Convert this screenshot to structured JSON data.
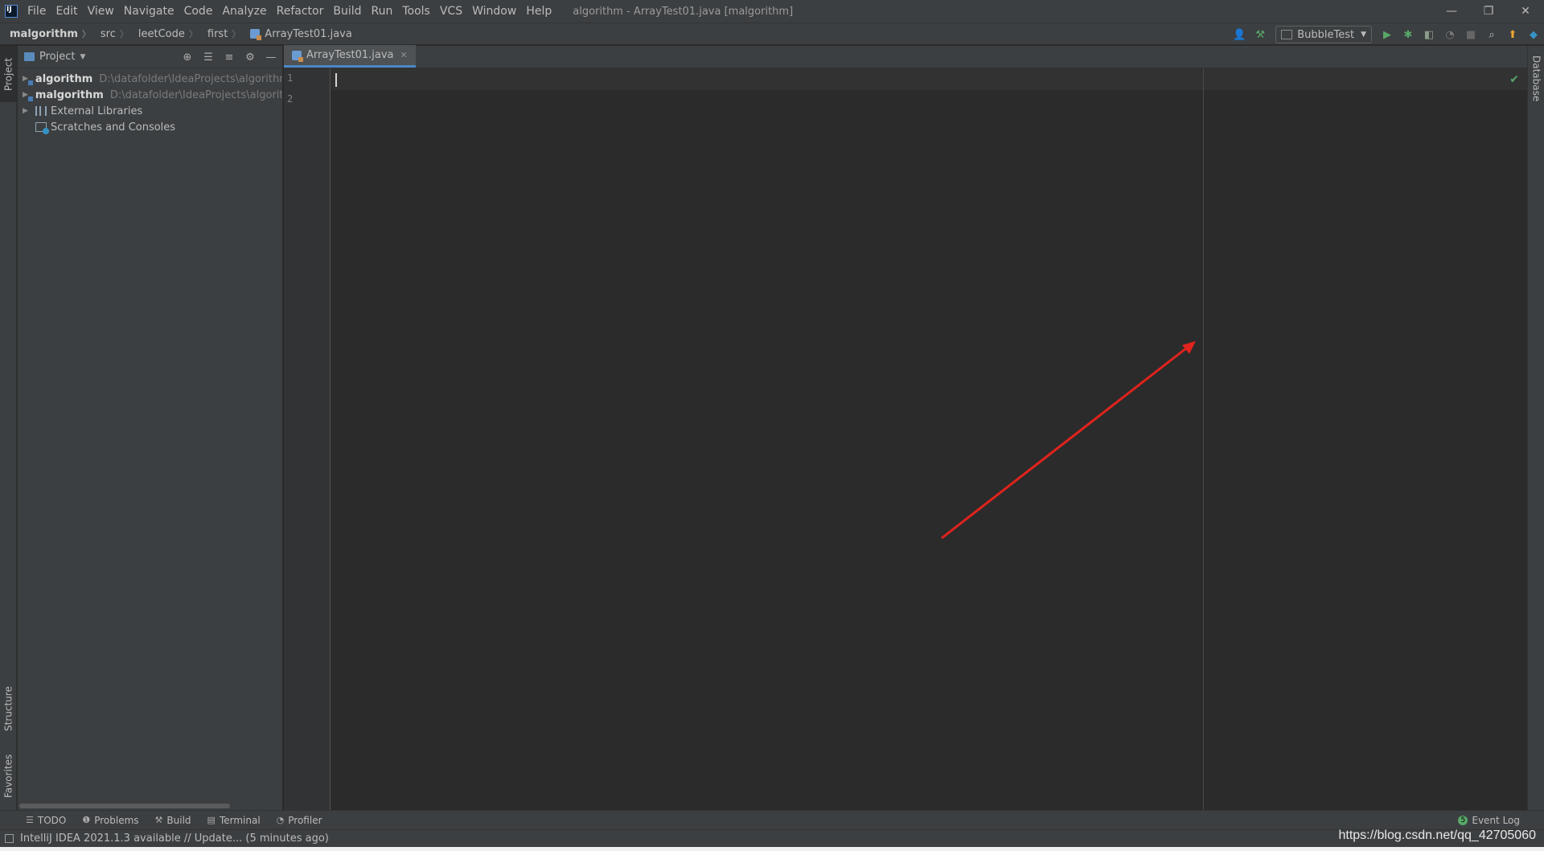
{
  "window": {
    "title": "algorithm - ArrayTest01.java [malgorithm]",
    "minimize": "—",
    "restore": "❐",
    "close": "✕"
  },
  "menu": [
    "File",
    "Edit",
    "View",
    "Navigate",
    "Code",
    "Analyze",
    "Refactor",
    "Build",
    "Run",
    "Tools",
    "VCS",
    "Window",
    "Help"
  ],
  "breadcrumb": [
    "malgorithm",
    "src",
    "leetCode",
    "first",
    "ArrayTest01.java"
  ],
  "toolbar": {
    "run_config": "BubbleTest"
  },
  "project_panel": {
    "title": "Project",
    "tree": [
      {
        "name": "algorithm",
        "path": "D:\\datafolder\\IdeaProjects\\algorithm\\"
      },
      {
        "name": "malgorithm",
        "path": "D:\\datafolder\\IdeaProjects\\algorithm"
      },
      {
        "name": "External Libraries"
      },
      {
        "name": "Scratches and Consoles"
      }
    ]
  },
  "left_stripe": {
    "project": "Project",
    "structure": "Structure",
    "favorites": "Favorites"
  },
  "right_stripe": {
    "database": "Database"
  },
  "editor": {
    "tab": "ArrayTest01.java",
    "line_numbers": [
      "1",
      "2"
    ]
  },
  "bottom_tabs": [
    "TODO",
    "Problems",
    "Build",
    "Terminal",
    "Profiler"
  ],
  "event_log": {
    "label": "Event Log",
    "count": "5"
  },
  "status": {
    "text": "IntelliJ IDEA 2021.1.3 available // Update... (5 minutes ago)"
  },
  "watermark": "https://blog.csdn.net/qq_42705060",
  "annotation": {
    "color": "#e0231c"
  }
}
